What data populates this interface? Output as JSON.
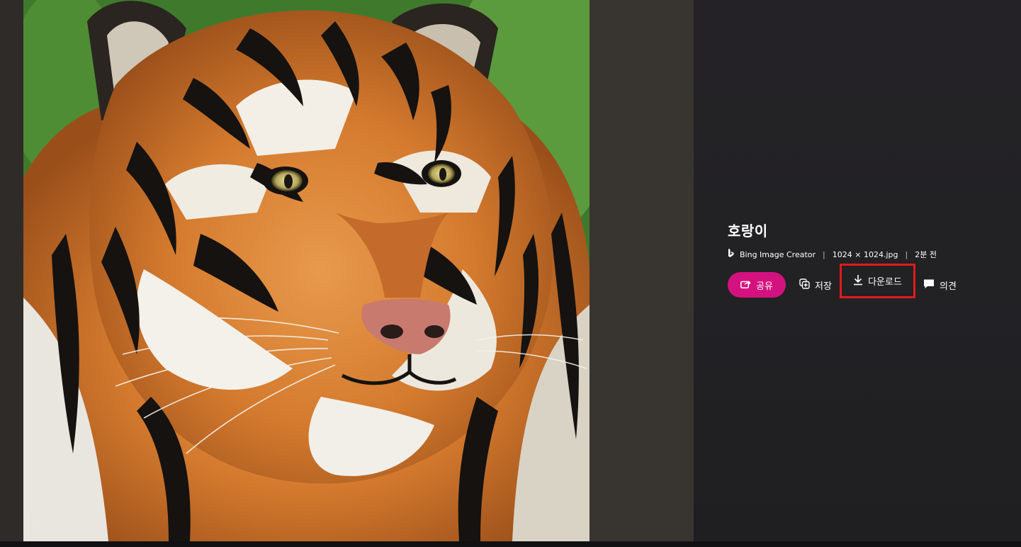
{
  "image": {
    "alt": "호랑이"
  },
  "details": {
    "title": "호랑이",
    "source": "Bing Image Creator",
    "file_info": "1024 × 1024.jpg",
    "time_ago": "2분 전",
    "separator": "|"
  },
  "actions": {
    "share_label": "공유",
    "save_label": "저장",
    "download_label": "다운로드",
    "feedback_label": "의견"
  },
  "icons": {
    "source": "bing-logo-icon",
    "share": "share-arrow-icon",
    "save": "add-collection-icon",
    "download": "download-icon",
    "feedback": "speech-bubble-icon",
    "watermark": "bing-watermark-icon"
  },
  "colors": {
    "share_button": "#d3127f",
    "highlight_border": "#e01b1b",
    "panel_background": "#232226",
    "text": "#ffffff"
  }
}
